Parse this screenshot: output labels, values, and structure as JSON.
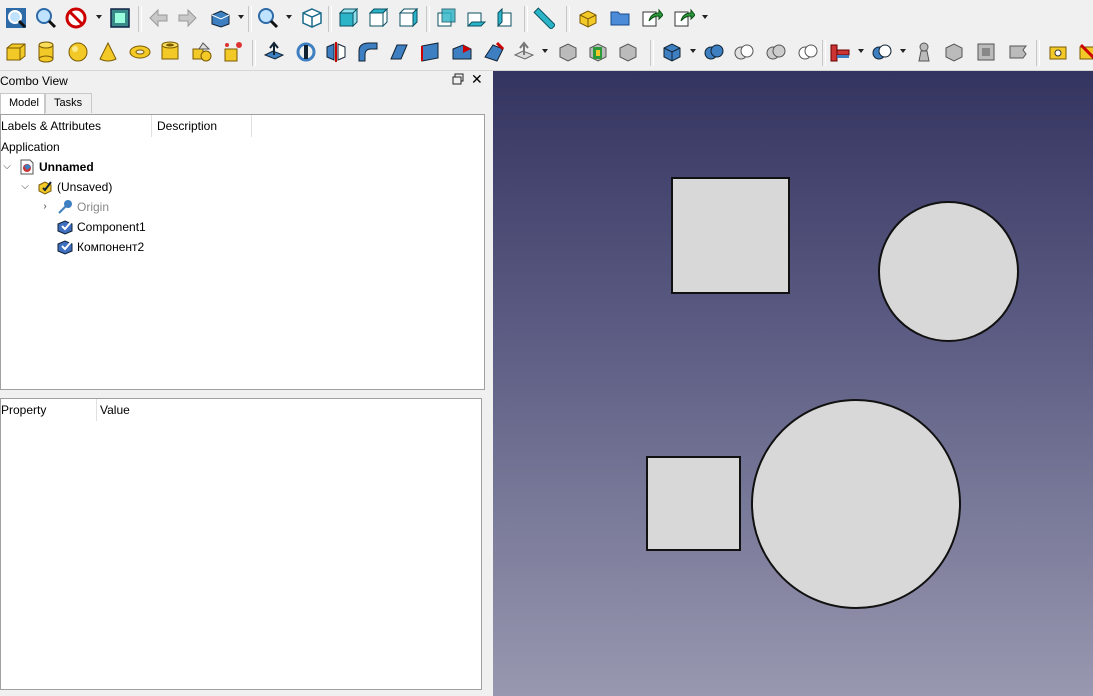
{
  "toolbar_top": {
    "icons": [
      "zoom-fit-all-icon",
      "zoom-fit-selection-icon",
      "draw-style-icon",
      "bounding-box-icon",
      "nav-back-icon",
      "nav-forward-icon",
      "sync-view-icon",
      "zoom-icon",
      "view-isometric-icon",
      "view-front-icon",
      "view-top-icon",
      "view-right-icon",
      "view-rear-icon",
      "view-bottom-icon",
      "view-left-icon",
      "measure-distance-icon",
      "part-icon",
      "group-folder-icon",
      "link-make-icon",
      "link-actions-icon"
    ]
  },
  "toolbar_part": {
    "icons": [
      "box-icon",
      "cylinder-icon",
      "sphere-icon",
      "cone-icon",
      "torus-icon",
      "tube-icon",
      "primitives-icon",
      "shape-builder-icon",
      "extrude-icon",
      "revolve-icon",
      "mirror-icon",
      "fillet-icon",
      "chamfer-icon",
      "make-face-icon",
      "ruled-surface-icon",
      "loft-icon",
      "sweep-icon",
      "section-icon",
      "cross-sections-icon",
      "offset-icon",
      "thickness-icon",
      "projection-icon",
      "compound-icon",
      "boolean-icon",
      "cut-icon",
      "fuse-icon",
      "common-icon",
      "join-features-icon",
      "split-features-icon",
      "compound-tools-icon",
      "check-geometry-icon",
      "defeaturing-icon",
      "attachment-icon",
      "measure-icon",
      "measure-clear-icon"
    ]
  },
  "combo_view": {
    "title": "Combo View",
    "tabs": [
      {
        "label": "Model"
      },
      {
        "label": "Tasks"
      }
    ],
    "tree": {
      "col_labels": "Labels & Attributes",
      "col_description": "Description",
      "root": "Application",
      "document": "Unnamed",
      "part": "(Unsaved)",
      "origin": "Origin",
      "component1": "Component1",
      "component2": "Компонент2"
    },
    "properties": {
      "col_property": "Property",
      "col_value": "Value"
    }
  },
  "view3d": {
    "background_top": "#343460",
    "background_bottom": "#9898b0",
    "shapes": [
      "square",
      "circle",
      "square",
      "circle"
    ]
  }
}
